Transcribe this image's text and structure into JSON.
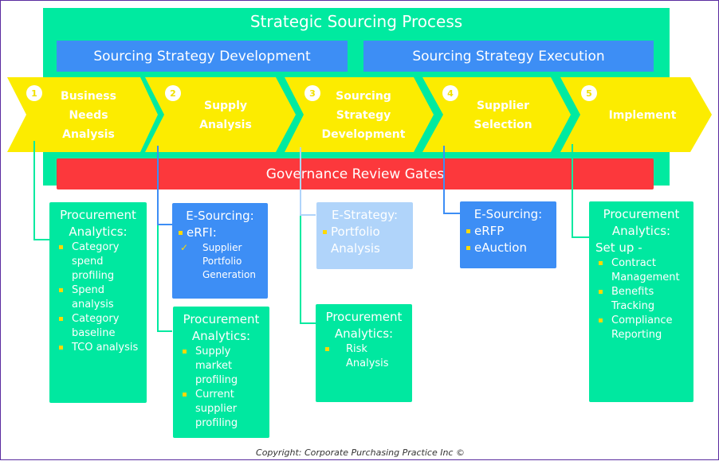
{
  "title": "Strategic Sourcing Process",
  "phases": [
    {
      "label": "Sourcing Strategy Development"
    },
    {
      "label": "Sourcing Strategy Execution"
    }
  ],
  "governance": "Governance Review Gates",
  "steps": [
    {
      "number": "1",
      "label": "Business Needs Analysis"
    },
    {
      "number": "2",
      "label": "Supply Analysis"
    },
    {
      "number": "3",
      "label": "Sourcing Strategy Development"
    },
    {
      "number": "4",
      "label": "Supplier Selection"
    },
    {
      "number": "5",
      "label": "Implement"
    }
  ],
  "boxes": {
    "step1_analytics": {
      "title": "Procurement Analytics:",
      "items": [
        "Category spend profiling",
        "Spend analysis",
        "Category baseline",
        "TCO analysis"
      ]
    },
    "step2_esourcing": {
      "title": "E-Sourcing:",
      "item": "eRFI:",
      "subitem": "Supplier Portfolio Generation",
      "check_icon": "✓"
    },
    "step2_analytics": {
      "title": "Procurement Analytics:",
      "items": [
        "Supply market profiling",
        "Current supplier profiling"
      ]
    },
    "step3_estrategy": {
      "title": "E-Strategy:",
      "item": "Portfolio Analysis"
    },
    "step3_analytics": {
      "title": "Procurement Analytics:",
      "items": [
        "Risk Analysis"
      ]
    },
    "step4_esourcing": {
      "title": "E-Sourcing:",
      "items": [
        "eRFP",
        "eAuction"
      ]
    },
    "step5_analytics": {
      "title": "Procurement Analytics:",
      "subtitle": "Set up -",
      "items": [
        "Contract Management",
        "Benefits Tracking",
        "Compliance Reporting"
      ]
    }
  },
  "copyright": "Copyright: Corporate Purchasing Practice Inc ©",
  "colors": {
    "green": "#00eaa0",
    "blue": "#3d8ef5",
    "light_blue": "#b0d4fa",
    "red": "#fc383c",
    "yellow": "#fcec00",
    "bullet": "#ffd900"
  }
}
